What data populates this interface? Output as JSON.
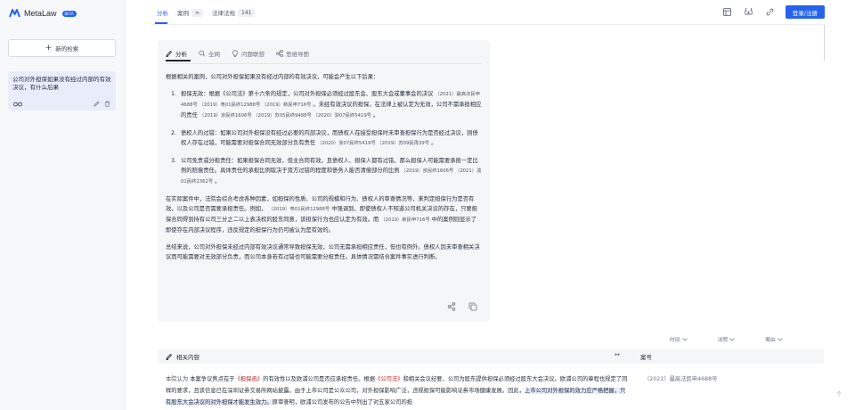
{
  "app": {
    "name": "MetaLaw",
    "badge": "BETA"
  },
  "sidebar": {
    "new_search": "新的检索",
    "history": [
      {
        "title": "公司对外担保如果没有经过内部的有效决议，有什么后果"
      }
    ]
  },
  "topbar": {
    "tabs": [
      {
        "label": "分析",
        "count": ""
      },
      {
        "label": "案例",
        "count": "∞"
      },
      {
        "label": "法律法规",
        "count": "141"
      }
    ],
    "login": "登录/注册"
  },
  "card": {
    "tabs": [
      "分析",
      "全网",
      "问题联想",
      "思维导图"
    ],
    "intro": "根据相关的案例，公司对外担保如果没有经过内部的有效决议，可能会产生以下后果：",
    "items": [
      {
        "num": "1.",
        "text": "担保无效：根据《公司法》第十六条的规定，公司对外担保必须经过股东会、股东大会或董事会的决议",
        "cite": "（2021）最高法民申4688号 （2019）粤01民终12988号 （2019）新民申716号",
        "text2": "。未经有效决议的担保，在法律上被认定为无效，公司不需承担相应的责任",
        "cite2": "（2019）京民终1606号 （2019）苏05民终9488号 （2020）浙07民终5419号",
        "tail": "。"
      },
      {
        "num": "2.",
        "text": "债权人的过错：如果公司对外担保没有经过必要的内部决议，而债权人在接受担保时未审查担保行为是否经过决议，则债权人存在过错，可能需要对担保合同无效部分负有责任",
        "cite": "（2020）浙07民终5419号 （2019）苏09民再39号",
        "text2": "。",
        "cite2": "",
        "tail": ""
      },
      {
        "num": "3.",
        "text": "公司免责或分担责任：如果担保合同无效，但主合同有效，且债权人、担保人都有过错，那么担保人可能需要承担一定比例的赔偿责任。具体责任的承担比例取决于双方过错的程度和债务人能否清偿部分的比例",
        "cite": "（2019）京民终1606号 （2021）渝01民终2362号",
        "text2": "。",
        "cite2": "",
        "tail": ""
      }
    ],
    "para2_a": "在实际案件中，法院会综合考虑各种因素，如担保的性质、公司的规模和行为、债权人的审查情况等，来判定担保行为是否有效，以及公司是否需要承担责任。例如，",
    "para2_cite1": "（2019）粤01民终12988号",
    "para2_b": "中强调到，即使债权人不知道公司机关决议的存在，只要担保合同得到持有公司三分之二以上表决权的股东同意，该担保行为也应认定为有效。而",
    "para2_cite2": "（2019）新民申716号",
    "para2_c": "中的案例则显示了即使存在内部决议程序，违反规定的担保行为仍可被认为是有效的。",
    "para3": "总结来说，公司对外担保未经过内部有效决议通常导致担保无效，公司无需承担相应责任，但也有例外。债权人因未审查相关决议而可能需要对无效部分负责，而公司本身若有过错也可能需要分担责任。具体情况需结合案件事实进行判断。"
  },
  "sort": [
    "时间",
    "法院",
    "案由"
  ],
  "related": {
    "title": "相关内容",
    "expand": "↔",
    "case_no_header": "案号",
    "kw": "本院认为",
    "p1": "本案争议焦点在于",
    "red1": "《担保函》",
    "p2": "的有效性以及欧浦公司是否应承担责任。根据",
    "red2": "《公司法》",
    "p3": "和相关会议纪要，公司为股东提供担保必须经过股东大会决议。欧浦公司的章程也规定了同样的要求，且该信息已在深圳证券交易所网站披露。由于上市公司是公众公司，对外担保影响广泛，违规担保可能影响证券市场健康发展。因此，",
    "hl": "上市公司对外担保的效力应严格把握，只有股东大会决议的对外担保才能发生效力。",
    "p4": "原审查明，欧浦公司发布的公告中列出了对五家公司的担",
    "case_no": "（2021）最高法民申4688号"
  },
  "colors": {
    "accent": "#2563eb",
    "card_bg": "#f5f6f8",
    "sidebar_bg": "#f7f8fa"
  },
  "icons": [
    "logo-icon",
    "plus-icon",
    "infinity-icon",
    "edit-icon",
    "trash-icon",
    "grid-icon",
    "save-icon",
    "link-icon",
    "pen-icon",
    "search-icon",
    "bulb-icon",
    "mindmap-icon",
    "share-icon",
    "copy-icon",
    "chevron-down-icon",
    "arrow-up-icon"
  ]
}
